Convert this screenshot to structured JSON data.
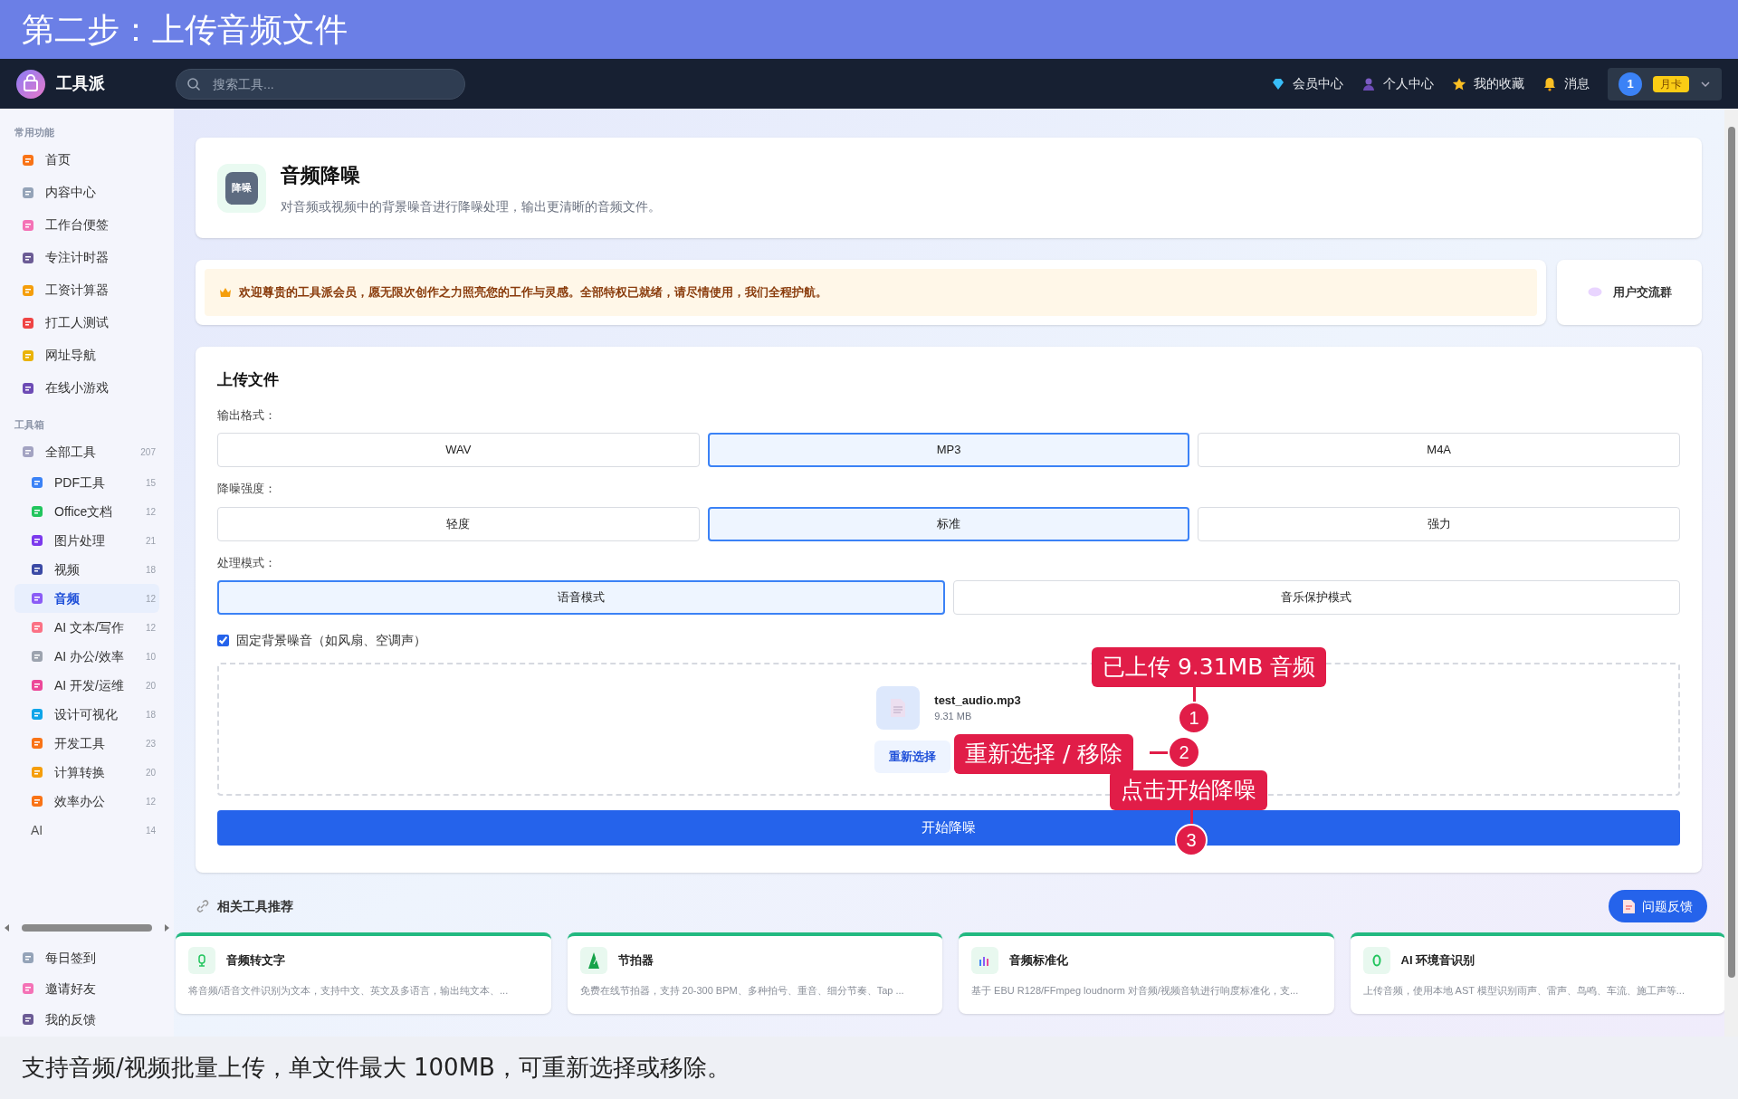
{
  "banner": {
    "title": "第二步：上传音频文件"
  },
  "navbar": {
    "brand": "工具派",
    "search": {
      "placeholder": "搜索工具..."
    },
    "links": [
      "会员中心",
      "个人中心",
      "我的收藏",
      "消息"
    ],
    "user": {
      "avatar": "1",
      "badge": "月卡"
    }
  },
  "sidebar": {
    "sections": [
      {
        "heading": "常用功能",
        "items": [
          {
            "label": "首页",
            "selected": false
          },
          {
            "label": "内容中心",
            "selected": false
          },
          {
            "label": "工作台便签",
            "selected": false
          },
          {
            "label": "专注计时器",
            "selected": false
          },
          {
            "label": "工资计算器",
            "selected": false
          },
          {
            "label": "打工人测试",
            "selected": false
          },
          {
            "label": "网址导航",
            "selected": false
          },
          {
            "label": "在线小游戏",
            "selected": false
          }
        ]
      },
      {
        "heading": "工具箱",
        "items": [
          {
            "label": "全部工具",
            "count": "207",
            "selected": false,
            "children": [
              {
                "label": "PDF工具",
                "count": "15",
                "selected": false
              },
              {
                "label": "Office文档",
                "count": "12",
                "selected": false
              },
              {
                "label": "图片处理",
                "count": "21",
                "selected": false
              },
              {
                "label": "视频",
                "count": "18",
                "selected": false
              },
              {
                "label": "音频",
                "count": "12",
                "selected": true
              },
              {
                "label": "AI 文本/写作",
                "count": "12",
                "selected": false
              },
              {
                "label": "AI 办公/效率",
                "count": "10",
                "selected": false
              },
              {
                "label": "AI 开发/运维",
                "count": "20",
                "selected": false
              },
              {
                "label": "设计可视化",
                "count": "18",
                "selected": false
              },
              {
                "label": "开发工具",
                "count": "23",
                "selected": false
              },
              {
                "label": "计算转换",
                "count": "20",
                "selected": false
              },
              {
                "label": "效率办公",
                "count": "12",
                "selected": false
              },
              {
                "label": "AI",
                "count": "14",
                "selected": false,
                "kind": "plain"
              }
            ]
          }
        ]
      }
    ],
    "footer_items": [
      "每日签到",
      "邀请好友",
      "我的反馈"
    ]
  },
  "tool": {
    "badge": "降噪",
    "title": "音频降噪",
    "description": "对音频或视频中的背景噪音进行降噪处理，输出更清晰的音频文件。"
  },
  "notice": {
    "text": "欢迎尊贵的工具派会员，愿无限次创作之力照亮您的工作与灵感。全部特权已就绪，请尽情使用，我们全程护航。",
    "side_button": "用户交流群"
  },
  "upload": {
    "title": "上传文件",
    "groups": [
      {
        "label": "输出格式：",
        "options": [
          {
            "label": "WAV",
            "selected": false
          },
          {
            "label": "MP3",
            "selected": true
          },
          {
            "label": "M4A",
            "selected": false
          }
        ]
      },
      {
        "label": "降噪强度：",
        "options": [
          {
            "label": "轻度",
            "selected": false
          },
          {
            "label": "标准",
            "selected": true
          },
          {
            "label": "强力",
            "selected": false
          }
        ]
      },
      {
        "label": "处理模式：",
        "options": [
          {
            "label": "语音模式",
            "selected": true
          },
          {
            "label": "音乐保护模式",
            "selected": false
          }
        ]
      }
    ],
    "checkbox": {
      "label": "固定背景噪音（如风扇、空调声）",
      "checked": true
    },
    "file": {
      "name": "test_audio.mp3",
      "size": "9.31 MB"
    },
    "reselect": "重新选择",
    "start": "开始降噪"
  },
  "related": {
    "title": "相关工具推荐",
    "cards": [
      {
        "title": "音频转文字",
        "description": "将音频/语音文件识别为文本，支持中文、英文及多语言，输出纯文本、..."
      },
      {
        "title": "节拍器",
        "description": "免费在线节拍器，支持 20-300 BPM、多种拍号、重音、细分节奏、Tap ..."
      },
      {
        "title": "音频标准化",
        "description": "基于 EBU R128/FFmpeg loudnorm 对音频/视频音轨进行响度标准化，支..."
      },
      {
        "title": "AI 环境音识别",
        "description": "上传音频，使用本地 AST 模型识别雨声、雷声、鸟鸣、车流、施工声等..."
      }
    ]
  },
  "feedback": "问题反馈",
  "annotations": [
    {
      "number": "1",
      "text": "已上传 9.31MB 音频"
    },
    {
      "number": "2",
      "text": "重新选择 / 移除"
    },
    {
      "number": "3",
      "text": "点击开始降噪"
    }
  ],
  "caption": "支持音频/视频批量上传，单文件最大 100MB，可重新选择或移除。"
}
